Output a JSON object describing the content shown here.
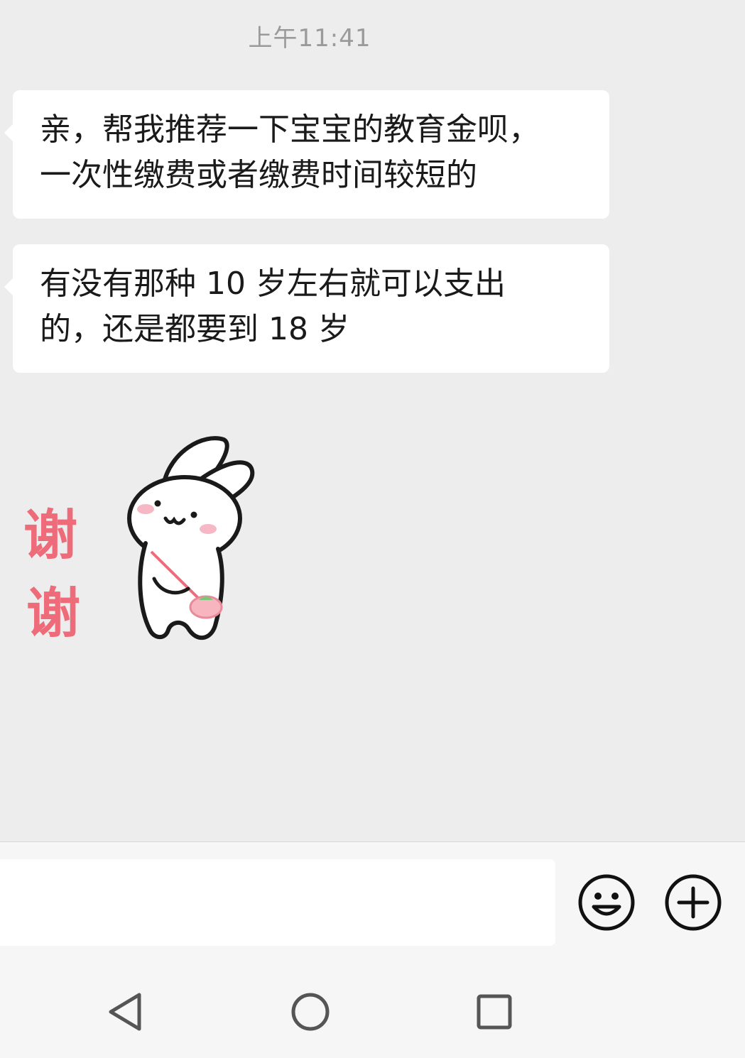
{
  "chat": {
    "timestamp": "上午11:41",
    "messages": [
      {
        "line1": "亲，帮我推荐一下宝宝的教育金呗，",
        "line2": "一次性缴费或者缴费时间较短的"
      },
      {
        "line1": "有没有那种 10 岁左右就可以支出",
        "line2": "的，还是都要到 18 岁"
      }
    ],
    "sticker": {
      "char1": "谢",
      "char2": "谢",
      "icon": "bunny-thanks-sticker"
    }
  },
  "input_bar": {
    "input_value": "",
    "emoji_icon": "smiley-icon",
    "plus_icon": "plus-circle-icon"
  },
  "nav_bar": {
    "back_icon": "back-triangle-icon",
    "home_icon": "home-circle-icon",
    "recent_icon": "recent-square-icon"
  },
  "colors": {
    "background": "#ededed",
    "bubble": "#ffffff",
    "sticker_text": "#ee6b7a"
  }
}
